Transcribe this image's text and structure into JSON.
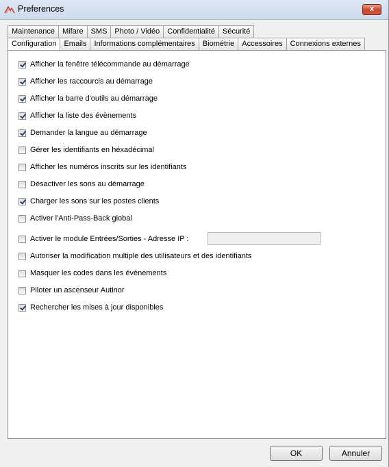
{
  "window": {
    "title": "Preferences",
    "close_label": "x"
  },
  "tabs": {
    "back_row": [
      "Maintenance",
      "Mifare",
      "SMS",
      "Photo / Vidéo",
      "Confidentialité",
      "Sécurité"
    ],
    "front_row": [
      "Configuration",
      "Emails",
      "Informations complémentaires",
      "Biométrie",
      "Accessoires",
      "Connexions externes"
    ],
    "active": "Configuration"
  },
  "options": [
    {
      "label": "Afficher la fenêtre télécommande au démarrage",
      "checked": true
    },
    {
      "label": "Afficher les raccourcis au démarrage",
      "checked": true
    },
    {
      "label": "Afficher la barre d'outils au démarrage",
      "checked": true
    },
    {
      "label": "Afficher la liste des évènements",
      "checked": true
    },
    {
      "label": "Demander la langue au démarrage",
      "checked": true
    },
    {
      "label": "Gérer les identifiants en héxadécimal",
      "checked": false
    },
    {
      "label": "Afficher les numéros inscrits sur les identifiants",
      "checked": false
    },
    {
      "label": "Désactiver les sons au démarrage",
      "checked": false
    },
    {
      "label": "Charger les sons sur les postes clients",
      "checked": true
    },
    {
      "label": "Activer l'Anti-Pass-Back global",
      "checked": false
    },
    {
      "label": "Activer le module Entrées/Sorties - Adresse IP :",
      "checked": false
    },
    {
      "label": "Autoriser la modification multiple des utilisateurs et des identifiants",
      "checked": false
    },
    {
      "label": "Masquer les codes dans les évènements",
      "checked": false
    },
    {
      "label": "Piloter un ascenseur Autinor",
      "checked": false
    },
    {
      "label": "Rechercher les mises à jour disponibles",
      "checked": true
    }
  ],
  "ip_address": {
    "value": ""
  },
  "buttons": {
    "ok": "OK",
    "cancel": "Annuler"
  }
}
